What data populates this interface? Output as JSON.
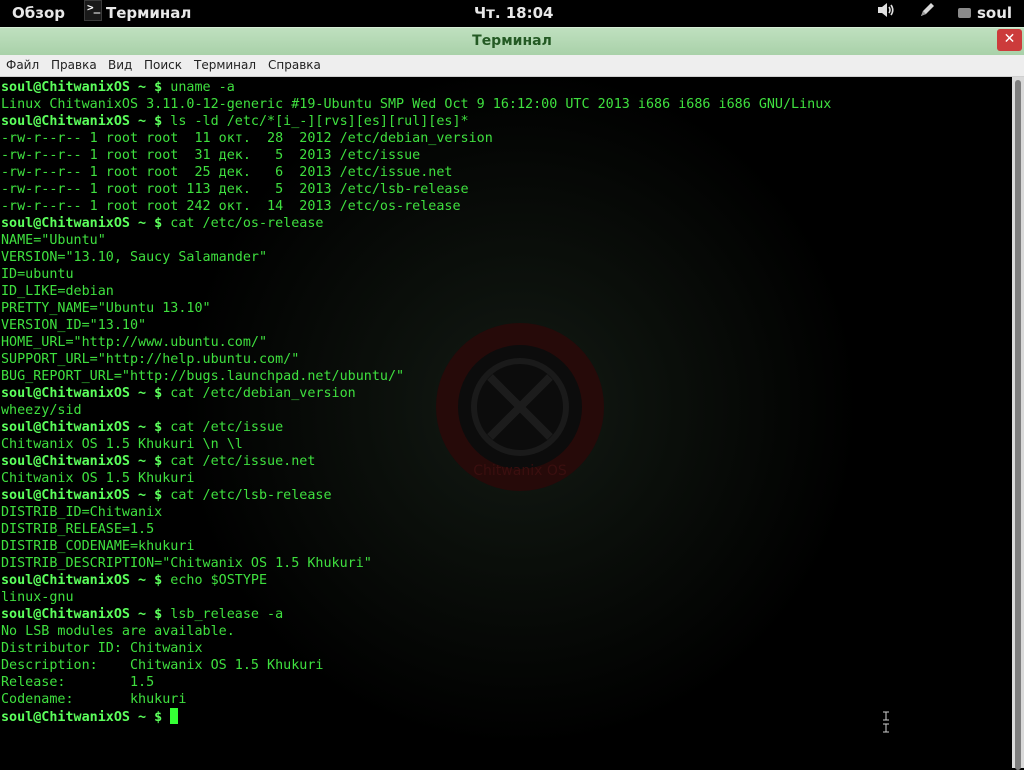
{
  "topbar": {
    "overview": "Обзор",
    "app_icon_glyph": ">_",
    "app_name": "Терминал",
    "clock": "Чт. 18:04",
    "user": "soul",
    "icons": [
      "volume-icon",
      "pen-icon",
      "chat-icon"
    ]
  },
  "window": {
    "title": "Терминал",
    "close_glyph": "✕",
    "menu": [
      "Файл",
      "Правка",
      "Вид",
      "Поиск",
      "Терминал",
      "Справка"
    ]
  },
  "watermark_text": "Chitwanix OS",
  "terminal": {
    "prompt": "soul@ChitwanixOS ~ $",
    "lines": [
      {
        "cmd": "uname -a"
      },
      {
        "out": "Linux ChitwanixOS 3.11.0-12-generic #19-Ubuntu SMP Wed Oct 9 16:12:00 UTC 2013 i686 i686 i686 GNU/Linux"
      },
      {
        "cmd": "ls -ld /etc/*[i_-][rvs][es][rul][es]*"
      },
      {
        "out": "-rw-r--r-- 1 root root  11 окт.  28  2012 /etc/debian_version"
      },
      {
        "out": "-rw-r--r-- 1 root root  31 дек.   5  2013 /etc/issue"
      },
      {
        "out": "-rw-r--r-- 1 root root  25 дек.   6  2013 /etc/issue.net"
      },
      {
        "out": "-rw-r--r-- 1 root root 113 дек.   5  2013 /etc/lsb-release"
      },
      {
        "out": "-rw-r--r-- 1 root root 242 окт.  14  2013 /etc/os-release"
      },
      {
        "cmd": "cat /etc/os-release"
      },
      {
        "out": "NAME=\"Ubuntu\""
      },
      {
        "out": "VERSION=\"13.10, Saucy Salamander\""
      },
      {
        "out": "ID=ubuntu"
      },
      {
        "out": "ID_LIKE=debian"
      },
      {
        "out": "PRETTY_NAME=\"Ubuntu 13.10\""
      },
      {
        "out": "VERSION_ID=\"13.10\""
      },
      {
        "out": "HOME_URL=\"http://www.ubuntu.com/\""
      },
      {
        "out": "SUPPORT_URL=\"http://help.ubuntu.com/\""
      },
      {
        "out": "BUG_REPORT_URL=\"http://bugs.launchpad.net/ubuntu/\""
      },
      {
        "cmd": "cat /etc/debian_version"
      },
      {
        "out": "wheezy/sid"
      },
      {
        "cmd": "cat /etc/issue"
      },
      {
        "out": "Chitwanix OS 1.5 Khukuri \\n \\l"
      },
      {
        "cmd": "cat /etc/issue.net"
      },
      {
        "out": "Chitwanix OS 1.5 Khukuri"
      },
      {
        "cmd": "cat /etc/lsb-release"
      },
      {
        "out": "DISTRIB_ID=Chitwanix"
      },
      {
        "out": "DISTRIB_RELEASE=1.5"
      },
      {
        "out": "DISTRIB_CODENAME=khukuri"
      },
      {
        "out": "DISTRIB_DESCRIPTION=\"Chitwanix OS 1.5 Khukuri\""
      },
      {
        "cmd": "echo $OSTYPE"
      },
      {
        "out": "linux-gnu"
      },
      {
        "cmd": "lsb_release -a"
      },
      {
        "out": "No LSB modules are available."
      },
      {
        "out": "Distributor ID:\tChitwanix"
      },
      {
        "out": "Description:\tChitwanix OS 1.5 Khukuri"
      },
      {
        "out": "Release:\t1.5"
      },
      {
        "out": "Codename:\tkhukuri"
      },
      {
        "cmd": "",
        "cursor": true
      }
    ]
  }
}
